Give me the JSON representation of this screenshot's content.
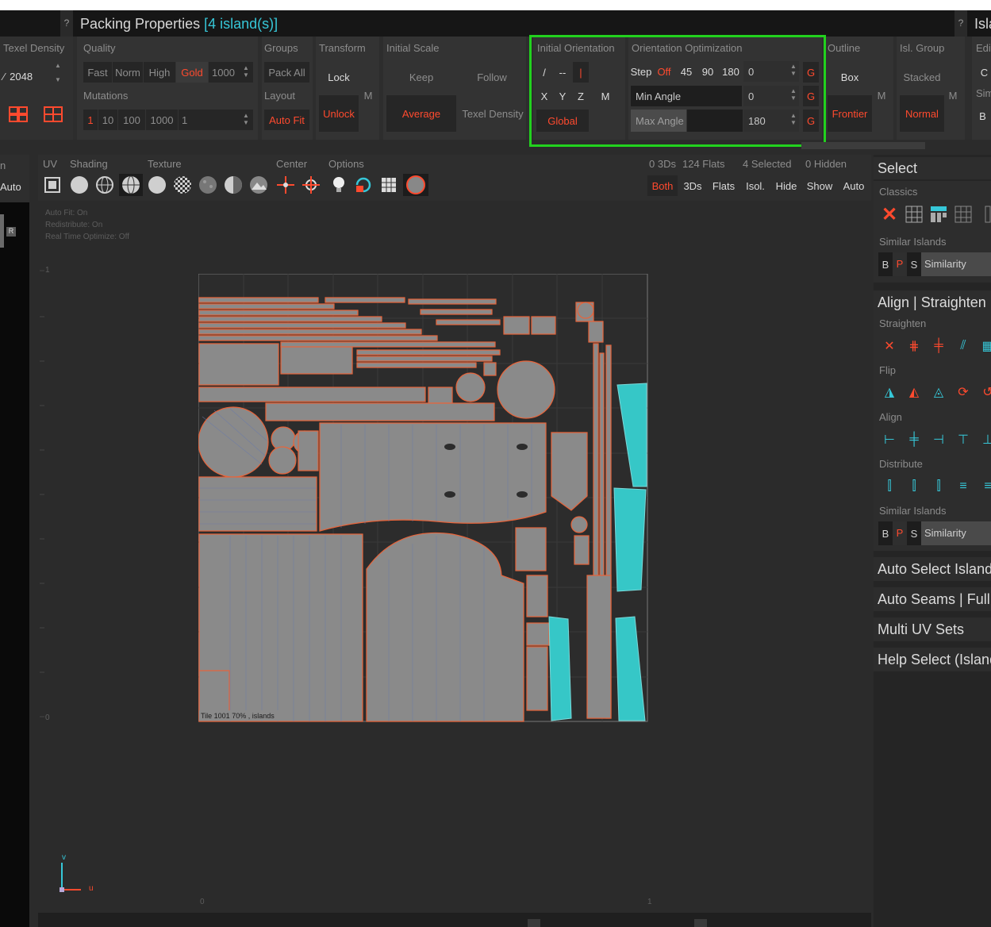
{
  "window": {
    "title": "Packing Properties",
    "title_accent": "[4 island(s)]",
    "help_glyph": "?",
    "right_title_stub": "Isla"
  },
  "toolbar": {
    "texel_density": {
      "label": "Texel Density",
      "value": "2048"
    },
    "quality": {
      "label": "Quality",
      "options": [
        "Fast",
        "Norm",
        "High",
        "Gold"
      ],
      "selected": "Gold",
      "value": "1000"
    },
    "mutations": {
      "label": "Mutations",
      "options": [
        "1",
        "10",
        "100",
        "1000"
      ],
      "selected": "1",
      "value": "1"
    },
    "groups": {
      "label": "Groups",
      "pack_all": "Pack All"
    },
    "layout": {
      "label": "Layout",
      "auto_fit": "Auto Fit"
    },
    "transform": {
      "label": "Transform",
      "lock": "Lock",
      "unlock": "Unlock",
      "m": "M"
    },
    "initial_scale": {
      "label": "Initial Scale",
      "keep": "Keep",
      "follow": "Follow",
      "average": "Average",
      "texel_density": "Texel Density"
    },
    "initial_orientation": {
      "label": "Initial Orientation",
      "slash": "/",
      "dashes": "--",
      "pipe": "|",
      "x": "X",
      "y": "Y",
      "z": "Z",
      "m": "M",
      "global": "Global"
    },
    "orientation_optimization": {
      "label": "Orientation Optimization",
      "step_label": "Step",
      "step_off": "Off",
      "steps": [
        "45",
        "90",
        "180"
      ],
      "step_value": "0",
      "min_angle_label": "Min Angle",
      "min_angle_value": "0",
      "max_angle_label": "Max Angle",
      "max_angle_value": "180",
      "g": "G"
    },
    "outline": {
      "label": "Outline",
      "box": "Box",
      "frontier": "Frontier",
      "m": "M"
    },
    "isl_group": {
      "label": "Isl. Group",
      "stacked": "Stacked",
      "normal": "Normal",
      "m": "M"
    },
    "right_stub": {
      "edit": "Edi",
      "c": "C",
      "sim": "Sim",
      "b": "B"
    }
  },
  "left_panel": {
    "stub_label": "n",
    "auto": "Auto"
  },
  "viewport_header": {
    "uv": "UV",
    "shading": "Shading",
    "texture": "Texture",
    "center": "Center",
    "options": "Options",
    "stats": {
      "threeds": "0 3Ds",
      "flats": "124 Flats",
      "selected": "4 Selected",
      "hidden": "0 Hidden"
    },
    "filters": [
      "Both",
      "3Ds",
      "Flats",
      "Isol.",
      "Hide",
      "Show",
      "Auto"
    ],
    "active_filter": "Both"
  },
  "viewport": {
    "overlay": [
      "Auto Fit: On",
      "Redistribute: On",
      "Real Time Optimize: Off"
    ],
    "tile_label": "Tile 1001 70% , islands",
    "ruler_top": "1",
    "ruler_bottom": "0",
    "ruler_x0": "0",
    "ruler_x1": "1",
    "axis_v": "v",
    "axis_u": "u"
  },
  "right_panel": {
    "select": "Select",
    "classics": "Classics",
    "similar_islands": "Similar Islands",
    "similarity": {
      "b": "B",
      "p": "P",
      "s": "S",
      "label": "Similarity"
    },
    "align_straighten": "Align | Straighten |",
    "straighten": "Straighten",
    "flip": "Flip",
    "align": "Align",
    "distribute": "Distribute",
    "similar_islands_2": "Similar Islands",
    "auto_select": "Auto Select Island",
    "auto_seams": "Auto Seams | Full ",
    "multi_uv": "Multi UV Sets",
    "help_select": "Help Select (Island"
  },
  "colors": {
    "accent_red": "#ff4a2e",
    "accent_cyan": "#36c7d8",
    "highlight_green": "#22d11e",
    "island_fill": "#8a8a8a",
    "island_border": "#e8643a"
  }
}
